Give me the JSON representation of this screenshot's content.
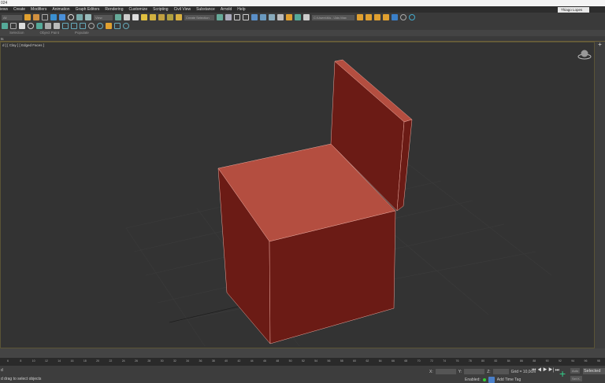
{
  "window": {
    "title": "024",
    "user": "Thiago Lopes"
  },
  "menu": [
    "iews",
    "Create",
    "Modifiers",
    "Animation",
    "Graph Editors",
    "Rendering",
    "Customize",
    "Scripting",
    "Civil View",
    "Substance",
    "Arnold",
    "Help"
  ],
  "toolbar": {
    "filter": "All",
    "ref_coord": "View",
    "selection_set": "Create Selection Set",
    "project_path": "C:\\Users\\Mo...\\3ds Max 2024"
  },
  "ribbon": {
    "tabs": [
      "Selection",
      "Object Paint",
      "Populate"
    ],
    "sub": "ts"
  },
  "viewport": {
    "label": "d ] [ Clay ] [ Edged Faces ]",
    "object_color": "#b44e40",
    "object_shadow": "#6b1b15"
  },
  "timeline": {
    "ticks": [
      6,
      8,
      10,
      12,
      14,
      16,
      18,
      20,
      22,
      24,
      26,
      28,
      30,
      32,
      34,
      36,
      38,
      40,
      42,
      44,
      46,
      48,
      50,
      52,
      54,
      56,
      58,
      60,
      62,
      64,
      66,
      68,
      70,
      72,
      74,
      76,
      78,
      80,
      82,
      84,
      86,
      88,
      90,
      92,
      94,
      96,
      98
    ]
  },
  "status": {
    "line1": "d",
    "line2": "d drag to select objects",
    "x_label": "X:",
    "y_label": "Y:",
    "z_label": "Z:",
    "grid": "Grid = 10,0cm",
    "enabled": "Enabled:",
    "add_time_tag": "Add Time Tag",
    "auto": "Auto",
    "set_k": "Set K.",
    "selected": "Selected"
  }
}
